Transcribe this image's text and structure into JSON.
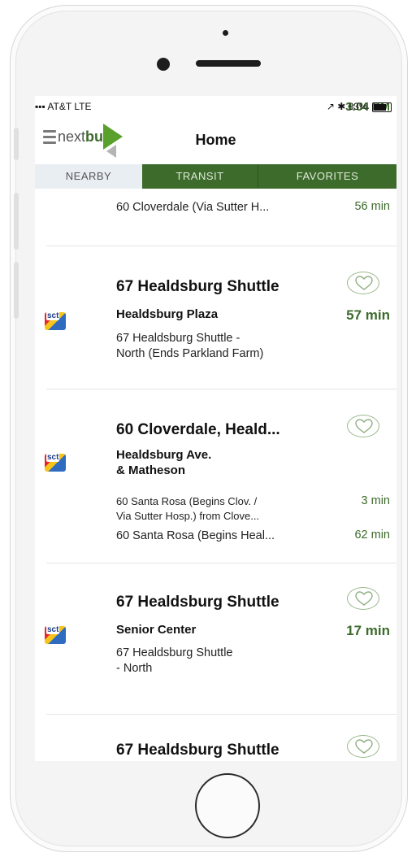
{
  "status_bar": {
    "carrier": "▪▪▪ AT&T  LTE",
    "time": "3:04 PM",
    "right": "↗ ✱ 83%",
    "battery_level": 0.83
  },
  "header": {
    "logo_plain": "next",
    "logo_bold": "bus",
    "title": "Home"
  },
  "tabs": [
    {
      "label": "NEARBY",
      "selected": true
    },
    {
      "label": "TRANSIT",
      "selected": false
    },
    {
      "label": "FAVORITES",
      "selected": false
    }
  ],
  "top_partial": {
    "direction": "60 Cloverdale (Via Sutter H...",
    "time": "56 min"
  },
  "routes": [
    {
      "title": "67 Healdsburg Shuttle",
      "stop": "Healdsburg Plaza",
      "time": "57 min",
      "direction_line1": "67 Healdsburg Shuttle -",
      "direction_line2": "North (Ends Parkland Farm)",
      "agency": "sct"
    },
    {
      "title": "60 Cloverdale, Heald...",
      "stop_line1": "Healdsburg Ave.",
      "stop_line2": "& Matheson",
      "dir1_line1": "60 Santa Rosa (Begins Clov. /",
      "dir1_line2": "Via Sutter Hosp.) from Clove...",
      "time1": "3 min",
      "dir2": "60 Santa Rosa (Begins Heal...",
      "time2": "62 min",
      "agency": "sct"
    },
    {
      "title": "67 Healdsburg Shuttle",
      "stop": "Senior Center",
      "time": "17 min",
      "direction_line1": "67 Healdsburg Shuttle",
      "direction_line2": "- North",
      "agency": "sct"
    },
    {
      "title": "67 Healdsburg Shuttle"
    }
  ],
  "colors": {
    "brand_green": "#3d6b2c",
    "accent_green": "#5aa02c"
  }
}
